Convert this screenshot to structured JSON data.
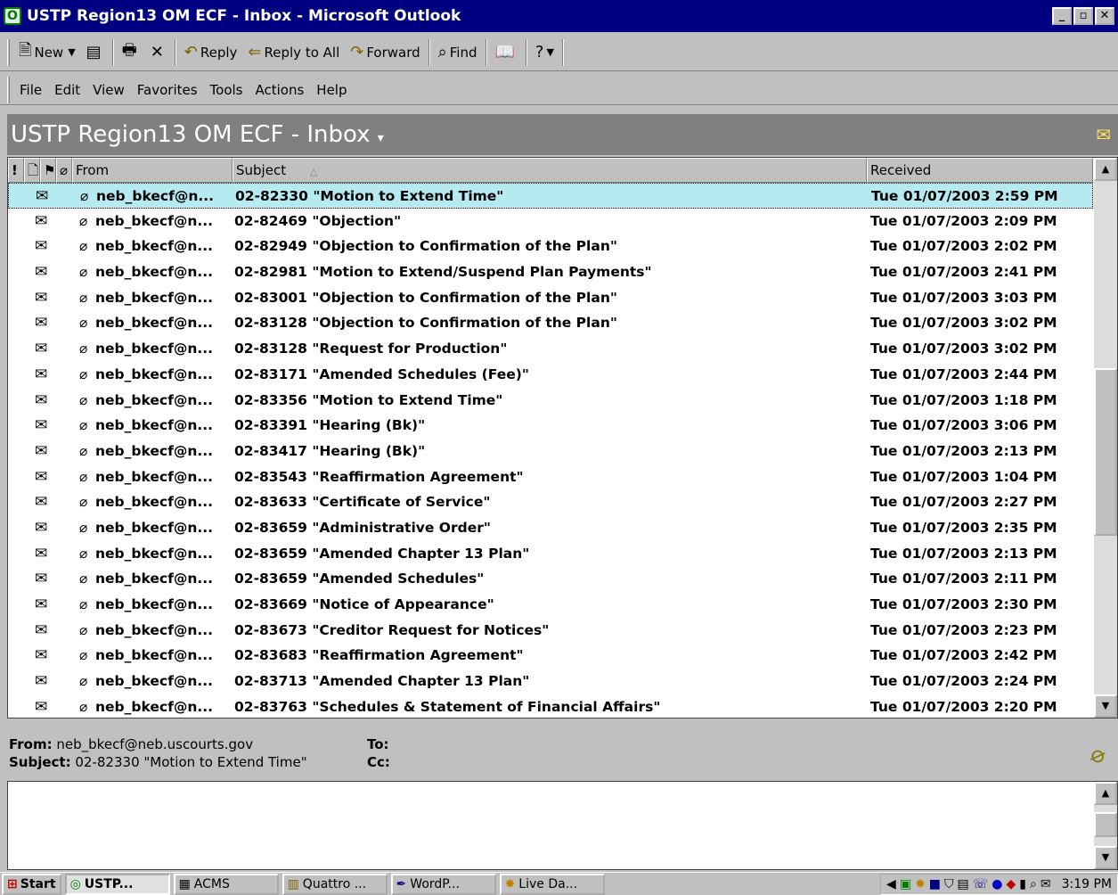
{
  "window": {
    "title": "USTP Region13 OM ECF - Inbox - Microsoft Outlook",
    "buttons": [
      "_",
      "▫",
      "✕"
    ]
  },
  "toolbar": {
    "new_label": "New",
    "reply_label": "Reply",
    "reply_all_label": "Reply to All",
    "forward_label": "Forward",
    "find_label": "Find"
  },
  "menu": [
    "File",
    "Edit",
    "View",
    "Favorites",
    "Tools",
    "Actions",
    "Help"
  ],
  "folder": {
    "title": "USTP Region13 OM ECF - Inbox"
  },
  "columns": {
    "from": "From",
    "subject": "Subject",
    "received": "Received"
  },
  "messages": [
    {
      "from": "neb_bkecf@n...",
      "subject": "02-82330 \"Motion to Extend Time\"",
      "received": "Tue 01/07/2003 2:59 PM",
      "selected": true
    },
    {
      "from": "neb_bkecf@n...",
      "subject": "02-82469 \"Objection\"",
      "received": "Tue 01/07/2003 2:09 PM"
    },
    {
      "from": "neb_bkecf@n...",
      "subject": "02-82949 \"Objection to Confirmation of the Plan\"",
      "received": "Tue 01/07/2003 2:02 PM"
    },
    {
      "from": "neb_bkecf@n...",
      "subject": "02-82981 \"Motion to Extend/Suspend Plan Payments\"",
      "received": "Tue 01/07/2003 2:41 PM"
    },
    {
      "from": "neb_bkecf@n...",
      "subject": "02-83001 \"Objection to Confirmation of the Plan\"",
      "received": "Tue 01/07/2003 3:03 PM"
    },
    {
      "from": "neb_bkecf@n...",
      "subject": "02-83128 \"Objection to Confirmation of the Plan\"",
      "received": "Tue 01/07/2003 3:02 PM"
    },
    {
      "from": "neb_bkecf@n...",
      "subject": "02-83128 \"Request for Production\"",
      "received": "Tue 01/07/2003 3:02 PM"
    },
    {
      "from": "neb_bkecf@n...",
      "subject": "02-83171 \"Amended Schedules (Fee)\"",
      "received": "Tue 01/07/2003 2:44 PM"
    },
    {
      "from": "neb_bkecf@n...",
      "subject": "02-83356 \"Motion to Extend Time\"",
      "received": "Tue 01/07/2003 1:18 PM"
    },
    {
      "from": "neb_bkecf@n...",
      "subject": "02-83391 \"Hearing (Bk)\"",
      "received": "Tue 01/07/2003 3:06 PM"
    },
    {
      "from": "neb_bkecf@n...",
      "subject": "02-83417 \"Hearing (Bk)\"",
      "received": "Tue 01/07/2003 2:13 PM"
    },
    {
      "from": "neb_bkecf@n...",
      "subject": "02-83543 \"Reaffirmation Agreement\"",
      "received": "Tue 01/07/2003 1:04 PM"
    },
    {
      "from": "neb_bkecf@n...",
      "subject": "02-83633 \"Certificate of Service\"",
      "received": "Tue 01/07/2003 2:27 PM"
    },
    {
      "from": "neb_bkecf@n...",
      "subject": "02-83659 \"Administrative Order\"",
      "received": "Tue 01/07/2003 2:35 PM"
    },
    {
      "from": "neb_bkecf@n...",
      "subject": "02-83659 \"Amended Chapter 13 Plan\"",
      "received": "Tue 01/07/2003 2:13 PM"
    },
    {
      "from": "neb_bkecf@n...",
      "subject": "02-83659 \"Amended Schedules\"",
      "received": "Tue 01/07/2003 2:11 PM"
    },
    {
      "from": "neb_bkecf@n...",
      "subject": "02-83669 \"Notice of Appearance\"",
      "received": "Tue 01/07/2003 2:30 PM"
    },
    {
      "from": "neb_bkecf@n...",
      "subject": "02-83673 \"Creditor Request for Notices\"",
      "received": "Tue 01/07/2003 2:23 PM"
    },
    {
      "from": "neb_bkecf@n...",
      "subject": "02-83683 \"Reaffirmation Agreement\"",
      "received": "Tue 01/07/2003 2:42 PM"
    },
    {
      "from": "neb_bkecf@n...",
      "subject": "02-83713 \"Amended Chapter 13 Plan\"",
      "received": "Tue 01/07/2003 2:24 PM"
    },
    {
      "from": "neb_bkecf@n...",
      "subject": "02-83763 \"Schedules & Statement of Financial Affairs\"",
      "received": "Tue 01/07/2003 2:20 PM"
    }
  ],
  "preview": {
    "from_label": "From:",
    "from_value": "neb_bkecf@neb.uscourts.gov",
    "subject_label": "Subject:",
    "subject_value": "02-82330 \"Motion to Extend Time\"",
    "to_label": "To:",
    "cc_label": "Cc:"
  },
  "taskbar": {
    "start_label": "Start",
    "tasks": [
      "USTP...",
      "ACMS",
      "Quattro ...",
      "WordP...",
      "Live Da..."
    ],
    "clock": "3:19 PM"
  }
}
